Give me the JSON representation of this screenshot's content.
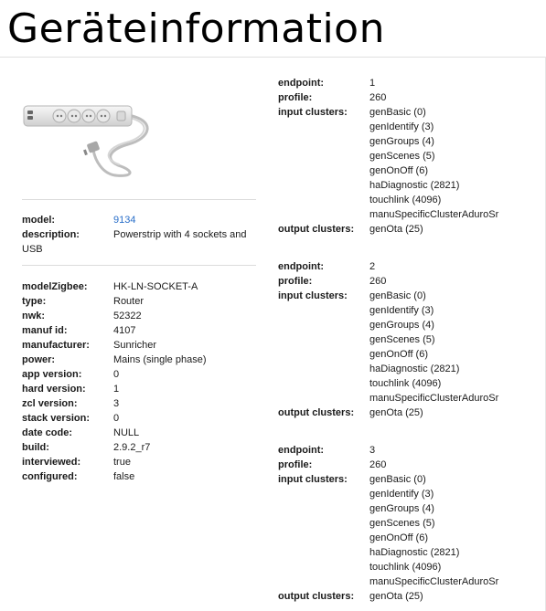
{
  "page": {
    "title": "Geräteinformation"
  },
  "device_summary": {
    "model_label": "model:",
    "model_value": "9134",
    "description_label": "description:",
    "description_value": "Powerstrip with 4 sockets and USB"
  },
  "device_details": [
    {
      "label": "modelZigbee:",
      "value": "HK-LN-SOCKET-A"
    },
    {
      "label": "type:",
      "value": "Router"
    },
    {
      "label": "nwk:",
      "value": "52322"
    },
    {
      "label": "manuf id:",
      "value": "4107"
    },
    {
      "label": "manufacturer:",
      "value": "Sunricher"
    },
    {
      "label": "power:",
      "value": "Mains (single phase)"
    },
    {
      "label": "app version:",
      "value": "0"
    },
    {
      "label": "hard version:",
      "value": "1"
    },
    {
      "label": "zcl version:",
      "value": "3"
    },
    {
      "label": "stack version:",
      "value": "0"
    },
    {
      "label": "date code:",
      "value": "NULL"
    },
    {
      "label": "build:",
      "value": "2.9.2_r7"
    },
    {
      "label": "interviewed:",
      "value": "true"
    },
    {
      "label": "configured:",
      "value": "false"
    }
  ],
  "endpoint_labels": {
    "endpoint": "endpoint:",
    "profile": "profile:",
    "input_clusters": "input clusters:",
    "output_clusters": "output clusters:"
  },
  "endpoints": [
    {
      "endpoint": "1",
      "profile": "260",
      "input_clusters": [
        "genBasic (0)",
        "genIdentify (3)",
        "genGroups (4)",
        "genScenes (5)",
        "genOnOff (6)",
        "haDiagnostic (2821)",
        "touchlink (4096)",
        "manuSpecificClusterAduroSr"
      ],
      "output_clusters": [
        "genOta (25)"
      ]
    },
    {
      "endpoint": "2",
      "profile": "260",
      "input_clusters": [
        "genBasic (0)",
        "genIdentify (3)",
        "genGroups (4)",
        "genScenes (5)",
        "genOnOff (6)",
        "haDiagnostic (2821)",
        "touchlink (4096)",
        "manuSpecificClusterAduroSr"
      ],
      "output_clusters": [
        "genOta (25)"
      ]
    },
    {
      "endpoint": "3",
      "profile": "260",
      "input_clusters": [
        "genBasic (0)",
        "genIdentify (3)",
        "genGroups (4)",
        "genScenes (5)",
        "genOnOff (6)",
        "haDiagnostic (2821)",
        "touchlink (4096)",
        "manuSpecificClusterAduroSr"
      ],
      "output_clusters": [
        "genOta (25)"
      ]
    }
  ]
}
